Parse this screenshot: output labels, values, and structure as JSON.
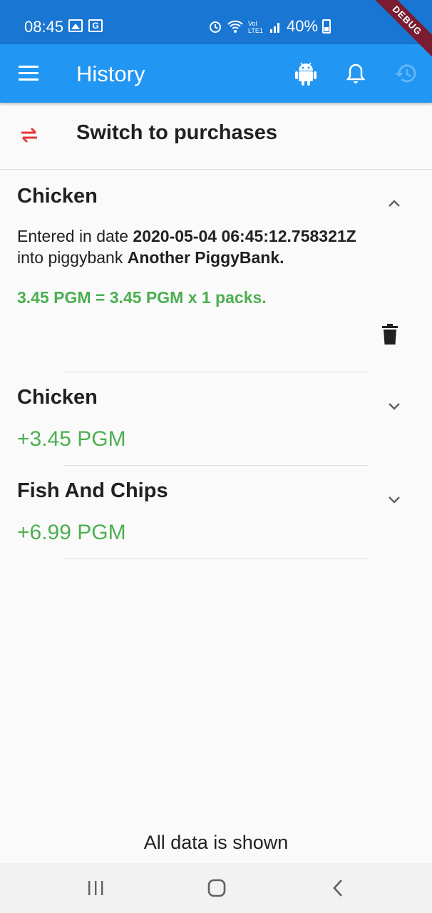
{
  "status_bar": {
    "time": "08:45",
    "battery": "40%"
  },
  "debug_ribbon": "DEBUG",
  "app_bar": {
    "title": "History",
    "icons": [
      "menu-icon",
      "android-icon",
      "bell-icon",
      "history-icon"
    ]
  },
  "switch": {
    "label": "Switch to purchases",
    "icon": "swap-arrows-icon"
  },
  "entries": [
    {
      "title": "Chicken",
      "expanded": true,
      "entered_prefix": "Entered in date ",
      "date": "2020-05-04 06:45:12.758321Z",
      "into_prefix": "into piggybank ",
      "piggybank": "Another PiggyBank.",
      "sum": "3.45 PGM = 3.45 PGM x 1 packs."
    },
    {
      "title": "Chicken",
      "expanded": false,
      "amount": "+3.45 PGM"
    },
    {
      "title": "Fish And Chips",
      "expanded": false,
      "amount": "+6.99 PGM"
    }
  ],
  "footer": {
    "text": "All data is shown"
  },
  "colors": {
    "status_bar": "#1976d2",
    "app_bar": "#2196f3",
    "positive": "#4caf50",
    "switch_icon": "#e53935"
  }
}
